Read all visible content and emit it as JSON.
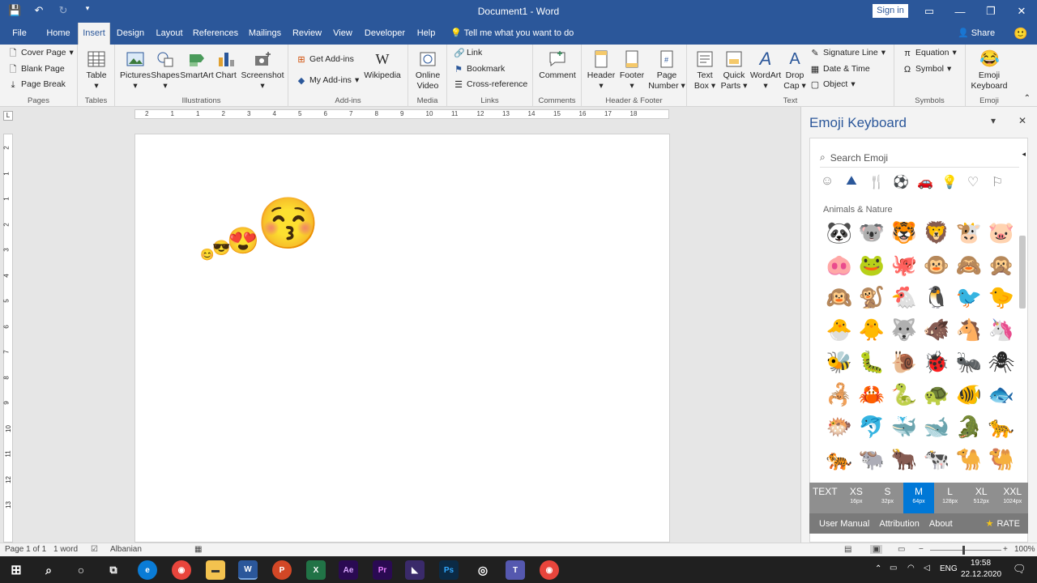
{
  "titlebar": {
    "title": "Document1  -  Word",
    "signin": "Sign in"
  },
  "tabs": [
    {
      "label": "File"
    },
    {
      "label": "Home"
    },
    {
      "label": "Insert",
      "active": true
    },
    {
      "label": "Design"
    },
    {
      "label": "Layout"
    },
    {
      "label": "References"
    },
    {
      "label": "Mailings"
    },
    {
      "label": "Review"
    },
    {
      "label": "View"
    },
    {
      "label": "Developer"
    },
    {
      "label": "Help"
    }
  ],
  "tellme": "Tell me what you want to do",
  "share": "Share",
  "ribbon": {
    "pages": {
      "label": "Pages",
      "cover": "Cover Page",
      "blank": "Blank Page",
      "break": "Page Break"
    },
    "tables": {
      "label": "Tables",
      "table": "Table"
    },
    "illustrations": {
      "label": "Illustrations",
      "pictures": "Pictures",
      "shapes": "Shapes",
      "smartart": "SmartArt",
      "chart": "Chart",
      "screenshot": "Screenshot"
    },
    "addins": {
      "label": "Add-ins",
      "get": "Get Add-ins",
      "my": "My Add-ins",
      "wikipedia": "Wikipedia"
    },
    "media": {
      "label": "Media",
      "video1": "Online",
      "video2": "Video"
    },
    "links": {
      "label": "Links",
      "link": "Link",
      "bookmark": "Bookmark",
      "xref": "Cross-reference"
    },
    "comments": {
      "label": "Comments",
      "comment": "Comment"
    },
    "hf": {
      "label": "Header & Footer",
      "header": "Header",
      "footer": "Footer",
      "pn1": "Page",
      "pn2": "Number"
    },
    "text": {
      "label": "Text",
      "tb1": "Text",
      "tb2": "Box",
      "qp1": "Quick",
      "qp2": "Parts",
      "wordart": "WordArt",
      "dc1": "Drop",
      "dc2": "Cap",
      "sig": "Signature Line",
      "date": "Date & Time",
      "object": "Object"
    },
    "symbols": {
      "label": "Symbols",
      "equation": "Equation",
      "symbol": "Symbol"
    },
    "emoji": {
      "label": "Emoji",
      "e1": "Emoji",
      "e2": "Keyboard"
    }
  },
  "ruler": {
    "h": [
      "2",
      "1",
      "1",
      "2",
      "3",
      "4",
      "5",
      "6",
      "7",
      "8",
      "9",
      "10",
      "11",
      "12",
      "13",
      "14",
      "15",
      "16",
      "17",
      "18"
    ],
    "v": [
      "2",
      "1",
      "1",
      "2",
      "3",
      "4",
      "5",
      "6",
      "7",
      "8",
      "9",
      "10",
      "11",
      "12",
      "13"
    ]
  },
  "doc_emojis": [
    "😊",
    "😎",
    "😍",
    "😚"
  ],
  "pane": {
    "title": "Emoji Keyboard",
    "search_placeholder": "Search Emoji",
    "categories": [
      "☺",
      "⛰",
      "🍴",
      "⚽",
      "🚗",
      "💡",
      "♡",
      "⚐"
    ],
    "category_heading": "Animals & Nature",
    "emojis": [
      "🐼",
      "🐨",
      "🐯",
      "🦁",
      "🐮",
      "🐷",
      "🐽",
      "🐸",
      "🐙",
      "🐵",
      "🙈",
      "🙊",
      "🙉",
      "🐒",
      "🐔",
      "🐧",
      "🐦",
      "🐤",
      "🐣",
      "🐥",
      "🐺",
      "🐗",
      "🐴",
      "🦄",
      "🐝",
      "🐛",
      "🐌",
      "🐞",
      "🐜",
      "🕷",
      "🦂",
      "🦀",
      "🐍",
      "🐢",
      "🐠",
      "🐟",
      "🐡",
      "🐬",
      "🐳",
      "🐋",
      "🐊",
      "🐆",
      "🐅",
      "🐃",
      "🐂",
      "🐄",
      "🐪",
      "🐫"
    ],
    "sizes": [
      {
        "label": "TEXT",
        "sub": ""
      },
      {
        "label": "XS",
        "sub": "16px"
      },
      {
        "label": "S",
        "sub": "32px"
      },
      {
        "label": "M",
        "sub": "64px",
        "on": true
      },
      {
        "label": "L",
        "sub": "128px"
      },
      {
        "label": "XL",
        "sub": "512px"
      },
      {
        "label": "XXL",
        "sub": "1024px"
      }
    ],
    "links": {
      "manual": "User Manual",
      "attribution": "Attribution",
      "about": "About",
      "rate": "RATE"
    }
  },
  "status": {
    "page": "Page 1 of 1",
    "words": "1 word",
    "lang": "Albanian",
    "zoom": "100%"
  },
  "taskbar": {
    "lang": "ENG",
    "time": "19:58",
    "date": "22.12.2020"
  }
}
